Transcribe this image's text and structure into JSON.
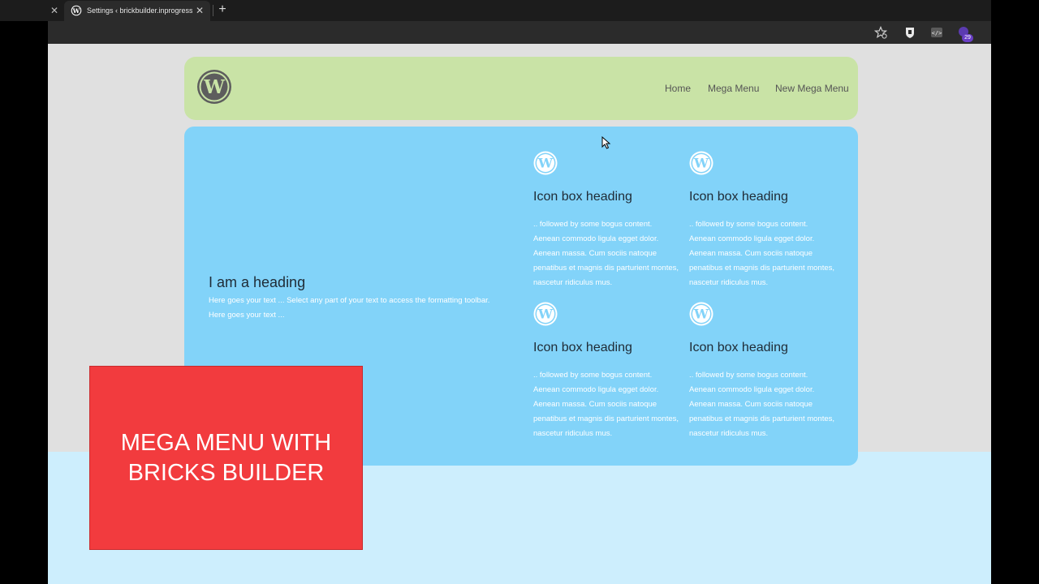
{
  "browser": {
    "tab_title": "Settings ‹ brickbuilder.inprogress",
    "tab_close_glyph": "✕",
    "left_close_glyph": "✕",
    "new_tab_glyph": "+",
    "toolbar_icons": [
      "favorites-star-icon",
      "shield-extension-icon",
      "code-extension-icon",
      "purple-extension-icon"
    ],
    "extension_badge": "29"
  },
  "site": {
    "logo_icon": "wordpress-logo-icon",
    "nav": [
      {
        "label": "Home"
      },
      {
        "label": "Mega Menu"
      },
      {
        "label": "New Mega Menu"
      }
    ]
  },
  "mega_menu": {
    "heading": "I am a heading",
    "text": "Here goes your text ... Select any part of your text to access the formatting toolbar. Here goes your text ...",
    "icon_boxes": [
      {
        "icon": "wordpress-icon",
        "heading": "Icon box heading",
        "text": ".. followed by some bogus content. Aenean commodo ligula egget dolor. Aenean massa. Cum sociis natoque penatibus et magnis dis parturient montes, nascetur ridiculus mus."
      },
      {
        "icon": "wordpress-icon",
        "heading": "Icon box heading",
        "text": ".. followed by some bogus content. Aenean commodo ligula egget dolor. Aenean massa. Cum sociis natoque penatibus et magnis dis parturient montes, nascetur ridiculus mus."
      },
      {
        "icon": "wordpress-icon",
        "heading": "Icon box heading",
        "text": ".. followed by some bogus content. Aenean commodo ligula egget dolor. Aenean massa. Cum sociis natoque penatibus et magnis dis parturient montes, nascetur ridiculus mus."
      },
      {
        "icon": "wordpress-icon",
        "heading": "Icon box heading",
        "text": ".. followed by some bogus content. Aenean commodo ligula egget dolor. Aenean massa. Cum sociis natoque penatibus et magnis dis parturient montes, nascetur ridiculus mus."
      }
    ]
  },
  "promo": {
    "line1": "MEGA MENU WITH",
    "line2": "BRICKS BUILDER"
  },
  "colors": {
    "header_bg": "#c9e3a6",
    "mega_bg": "#82d3f9",
    "promo_bg": "#f23b3e",
    "page_bg": "#e0e0e0",
    "bottom_band": "#cdeefd"
  }
}
